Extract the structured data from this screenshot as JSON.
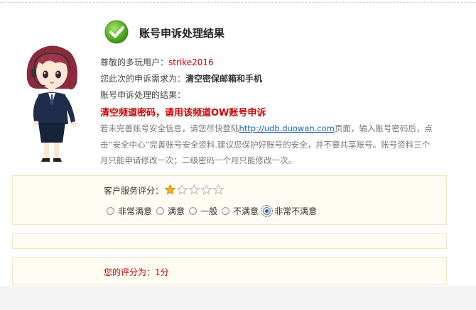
{
  "page": {
    "title": "账号申诉处理结果",
    "greeting_label": "尊敬的多玩用户：",
    "username": "strike2016",
    "request_label": "您此次的申诉需求为：",
    "request_value": "清空密保邮箱和手机",
    "result_label": "账号申诉处理的结果：",
    "result_value": "清空频道密码，请用该频道OW账号申诉",
    "notice_part1": "若未完善账号安全信息，请您尽快登陆",
    "notice_link": "http://udb.duowan.com",
    "notice_part2": "页面，输入账号密码后，点击“安全中心”完善账号安全资料.建议您保护好账号的安全，并不要共享账号。账号资料三个月只能申请修改一次；二级密码一个月只能修改一次。"
  },
  "rating": {
    "label": "客户服务评分：",
    "stars_total": 5,
    "stars_filled": 1,
    "options": [
      "非常满意",
      "满意",
      "一般",
      "不满意",
      "非常不满意"
    ],
    "selected_index": 4
  },
  "score": {
    "label": "您的评分为：",
    "value": "1分"
  },
  "colors": {
    "accent_red": "#cc0000",
    "link_blue": "#1a5fb4",
    "panel_bg": "#fffdf3",
    "panel_border": "#f1e6c5",
    "check_green": "#5cb82a"
  }
}
